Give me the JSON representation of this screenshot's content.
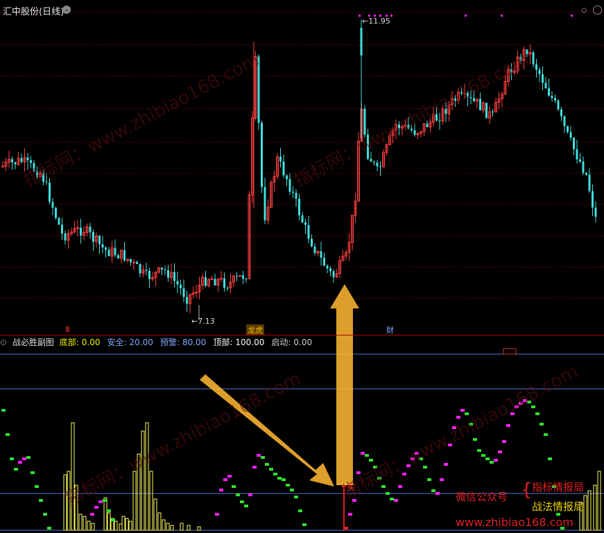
{
  "header": {
    "title": "汇中股份(日线)",
    "chevron": "⌄"
  },
  "price_labels": {
    "high": "←11.95",
    "low": "←7.13"
  },
  "markers": {
    "m1": "8",
    "m2": "龙虎",
    "m3": "财"
  },
  "indicator": {
    "name": "战必胜副图",
    "items": [
      {
        "label": "底部:",
        "value": "0.00",
        "color": "#f0f000"
      },
      {
        "label": "安全:",
        "value": "20.00",
        "color": "#80a8ff"
      },
      {
        "label": "预警:",
        "value": "80.00",
        "color": "#80a8ff"
      },
      {
        "label": "顶部:",
        "value": "100.00",
        "color": "#ffffff"
      },
      {
        "label": "启动:",
        "value": "0.00",
        "color": "#cccccc"
      }
    ],
    "buy_label": "买"
  },
  "watermark": {
    "diagonal": "指标网：www.zhibiao168.com",
    "wechat": "微信公众号",
    "line1": "指标情报局",
    "line2": "战法情报局",
    "url": "www.zhibiao168.com"
  },
  "colors": {
    "up": "#ff4040",
    "down": "#40e0e0",
    "grid": "#8b0000",
    "level": "#5a78d0",
    "magenta": "#ff20ff",
    "green": "#30e030",
    "yellow": "#ffff60",
    "arrow": "#f5b030"
  },
  "chart_data": {
    "type": "candlestick",
    "annotated_high": 11.95,
    "annotated_low": 7.13,
    "indicator_levels": [
      0,
      20,
      80,
      100
    ]
  }
}
